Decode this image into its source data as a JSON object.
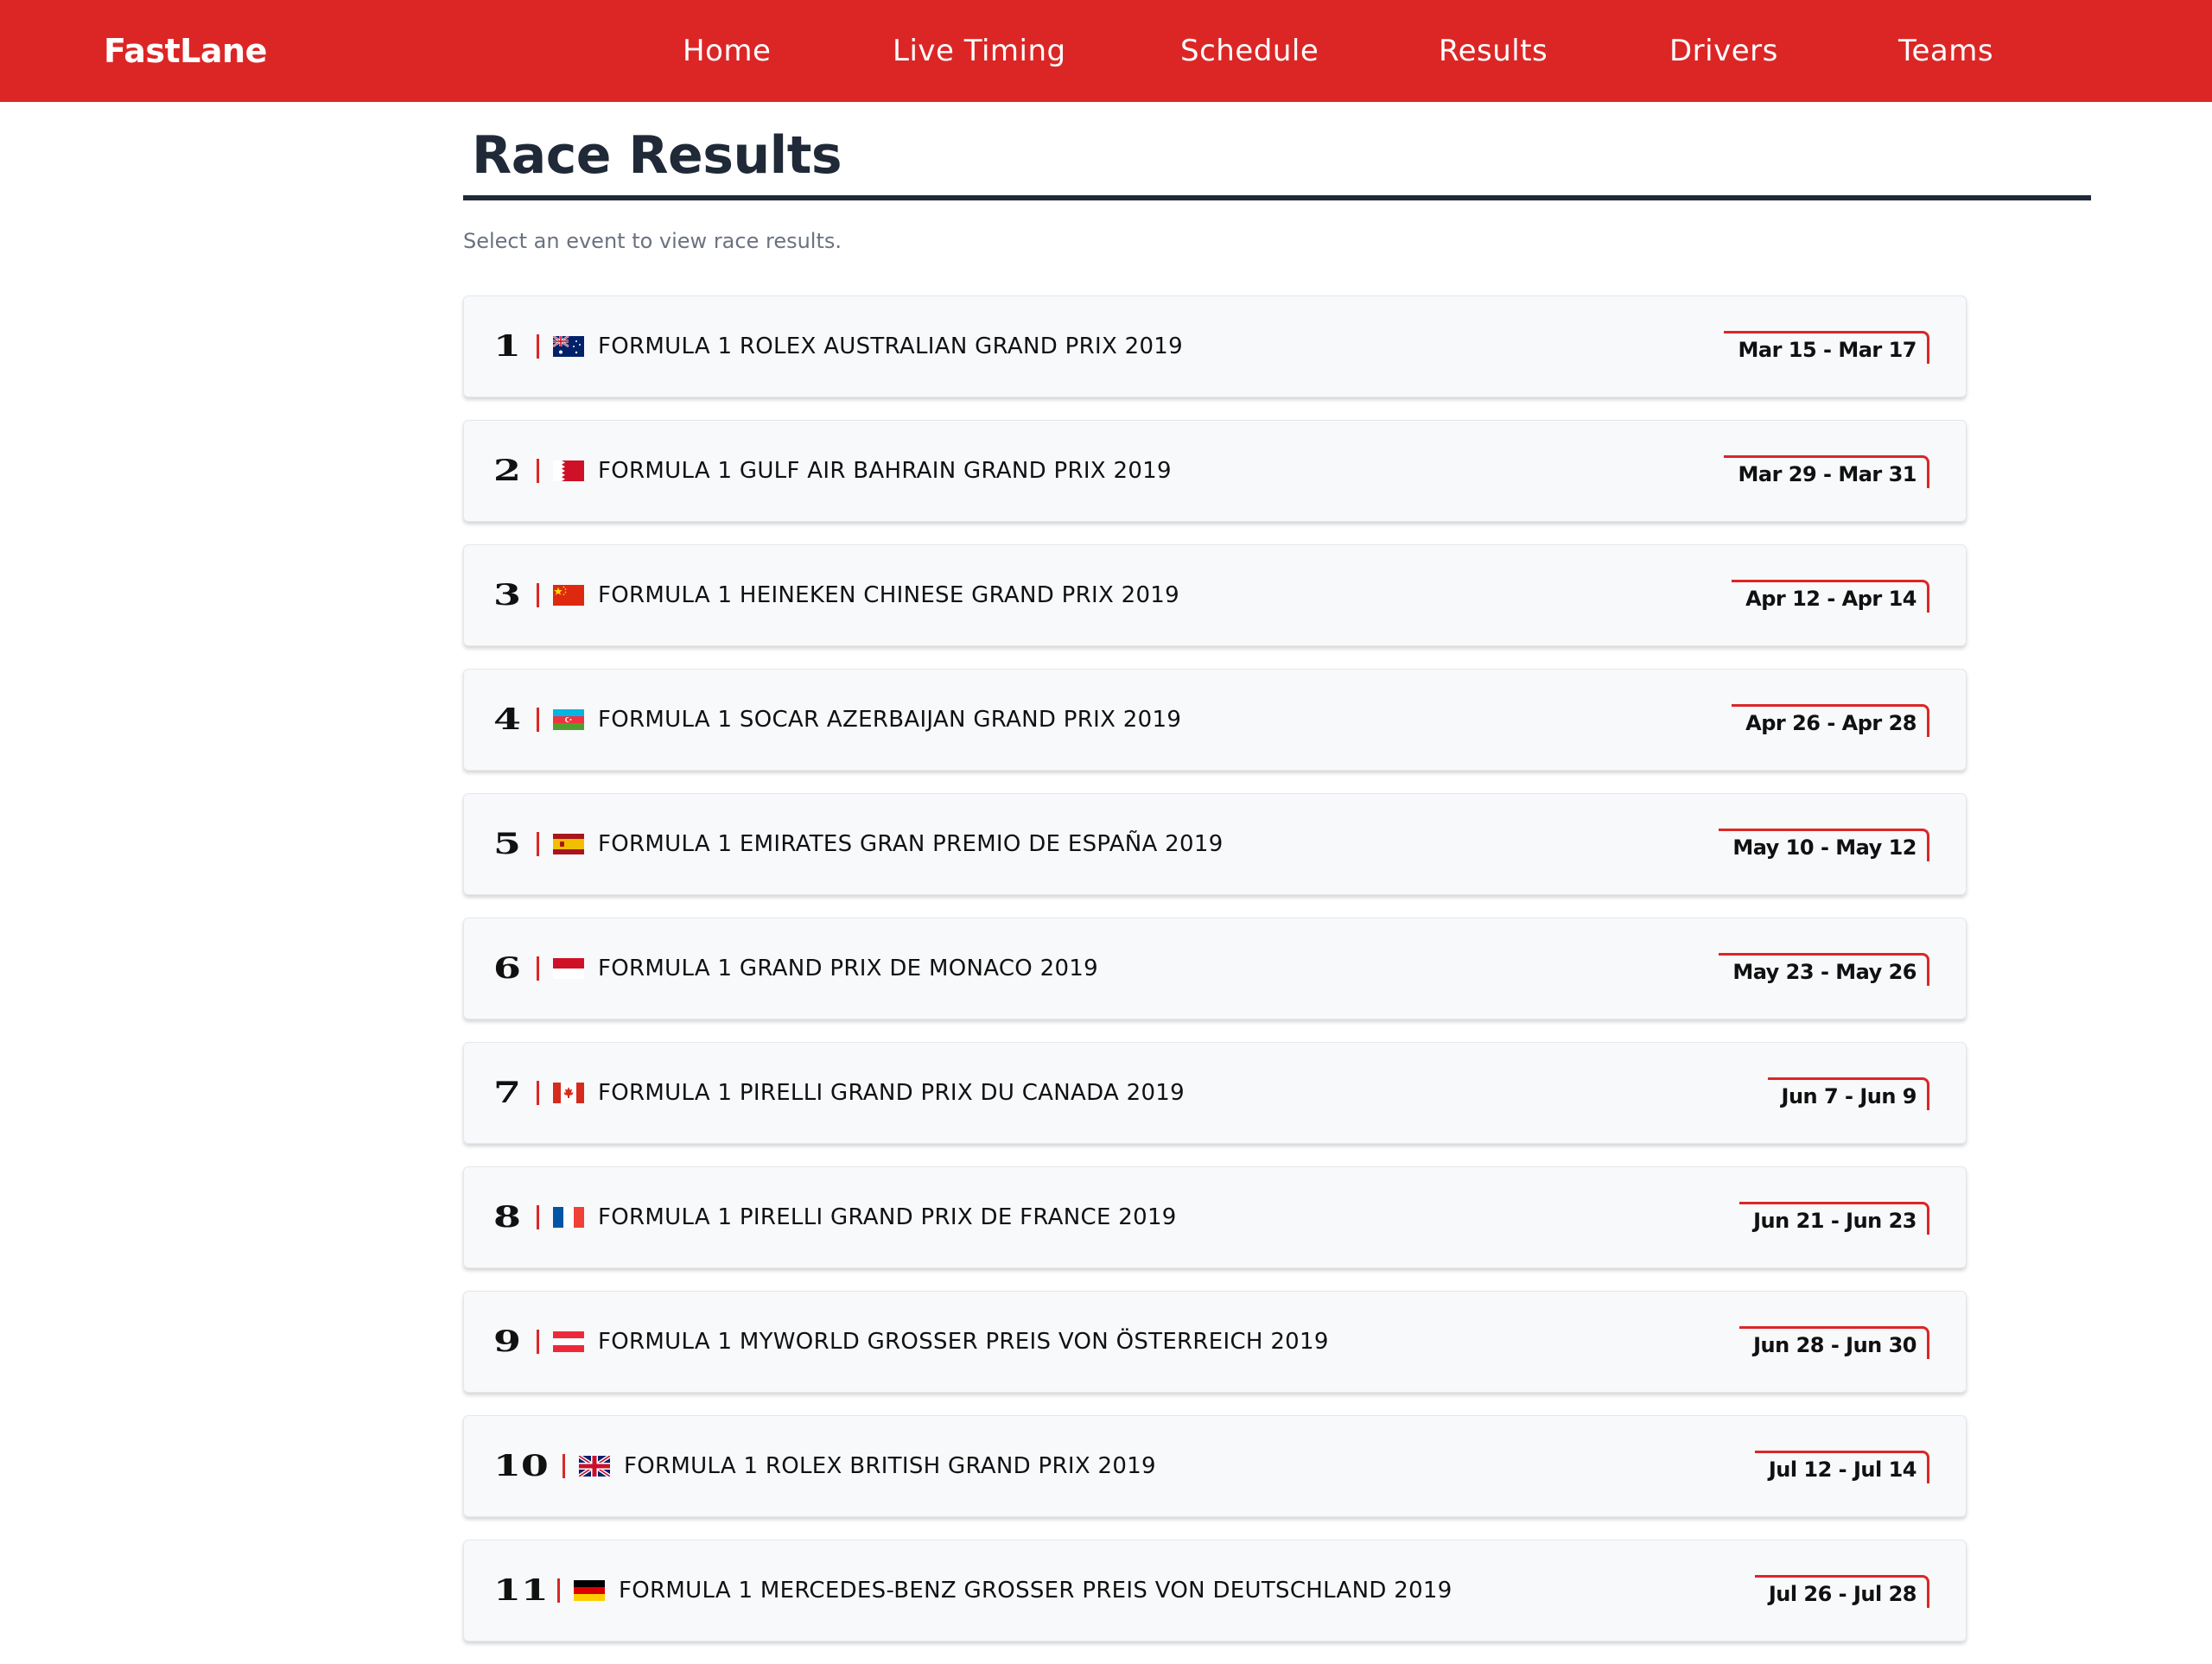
{
  "header": {
    "brand": "FastLane",
    "nav": [
      {
        "label": "Home"
      },
      {
        "label": "Live Timing"
      },
      {
        "label": "Schedule"
      },
      {
        "label": "Results"
      },
      {
        "label": "Drivers"
      },
      {
        "label": "Teams"
      }
    ],
    "color": "#dc2626"
  },
  "page": {
    "title": "Race Results",
    "subtitle": "Select an event to view race results."
  },
  "events": [
    {
      "round": "1",
      "flag": "australia-flag-icon",
      "name": "FORMULA 1 ROLEX AUSTRALIAN GRAND PRIX 2019",
      "dates": "Mar 15 - Mar 17"
    },
    {
      "round": "2",
      "flag": "bahrain-flag-icon",
      "name": "FORMULA 1 GULF AIR BAHRAIN GRAND PRIX 2019",
      "dates": "Mar 29 - Mar 31"
    },
    {
      "round": "3",
      "flag": "china-flag-icon",
      "name": "FORMULA 1 HEINEKEN CHINESE GRAND PRIX 2019",
      "dates": "Apr 12 - Apr 14"
    },
    {
      "round": "4",
      "flag": "azerbaijan-flag-icon",
      "name": "FORMULA 1 SOCAR AZERBAIJAN GRAND PRIX 2019",
      "dates": "Apr 26 - Apr 28"
    },
    {
      "round": "5",
      "flag": "spain-flag-icon",
      "name": "FORMULA 1 EMIRATES GRAN PREMIO DE ESPAÑA 2019",
      "dates": "May 10 - May 12"
    },
    {
      "round": "6",
      "flag": "monaco-flag-icon",
      "name": "FORMULA 1 GRAND PRIX DE MONACO 2019",
      "dates": "May 23 - May 26"
    },
    {
      "round": "7",
      "flag": "canada-flag-icon",
      "name": "FORMULA 1 PIRELLI GRAND PRIX DU CANADA 2019",
      "dates": "Jun 7 - Jun 9"
    },
    {
      "round": "8",
      "flag": "france-flag-icon",
      "name": "FORMULA 1 PIRELLI GRAND PRIX DE FRANCE 2019",
      "dates": "Jun 21 - Jun 23"
    },
    {
      "round": "9",
      "flag": "austria-flag-icon",
      "name": "FORMULA 1 MYWORLD GROSSER PREIS VON ÖSTERREICH 2019",
      "dates": "Jun 28 - Jun 30"
    },
    {
      "round": "10",
      "flag": "uk-flag-icon",
      "name": "FORMULA 1 ROLEX BRITISH GRAND PRIX 2019",
      "dates": "Jul 12 - Jul 14"
    },
    {
      "round": "11",
      "flag": "germany-flag-icon",
      "name": "FORMULA 1 MERCEDES-BENZ GROSSER PREIS VON DEUTSCHLAND 2019",
      "dates": "Jul 26 - Jul 28"
    }
  ]
}
